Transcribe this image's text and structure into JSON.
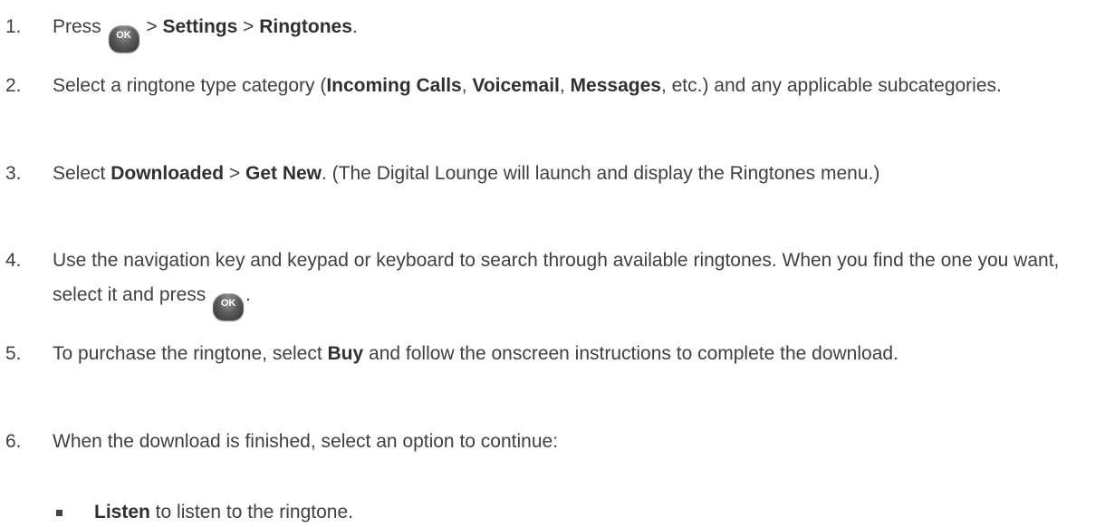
{
  "steps": [
    {
      "number": "1.",
      "parts": [
        "Press ",
        "OK",
        " > ",
        "Settings",
        " > ",
        "Ringtones",
        "."
      ]
    },
    {
      "number": "2.",
      "parts": [
        "Select a ringtone type category (",
        "Incoming Calls",
        ", ",
        "Voicemail",
        ", ",
        "Messages",
        ", etc.) and any applicable subcategories."
      ]
    },
    {
      "number": "3.",
      "parts": [
        "Select ",
        "Downloaded",
        " > ",
        "Get New",
        ". (The Digital Lounge will launch and display the Ringtones menu.)"
      ]
    },
    {
      "number": "4.",
      "parts": [
        "Use the navigation key and keypad or keyboard to search through available ringtones. When you find the one you want, select it and press ",
        "OK",
        "."
      ]
    },
    {
      "number": "5.",
      "parts": [
        "To purchase the ringtone, select ",
        "Buy",
        " and follow the onscreen instructions to complete the download."
      ]
    },
    {
      "number": "6.",
      "parts": [
        "When the download is finished, select an option to continue:"
      ]
    }
  ],
  "bullets": [
    {
      "parts": [
        "Listen",
        " to listen to the ringtone."
      ]
    }
  ],
  "icons": {
    "ok_key": "ok-key-icon"
  }
}
